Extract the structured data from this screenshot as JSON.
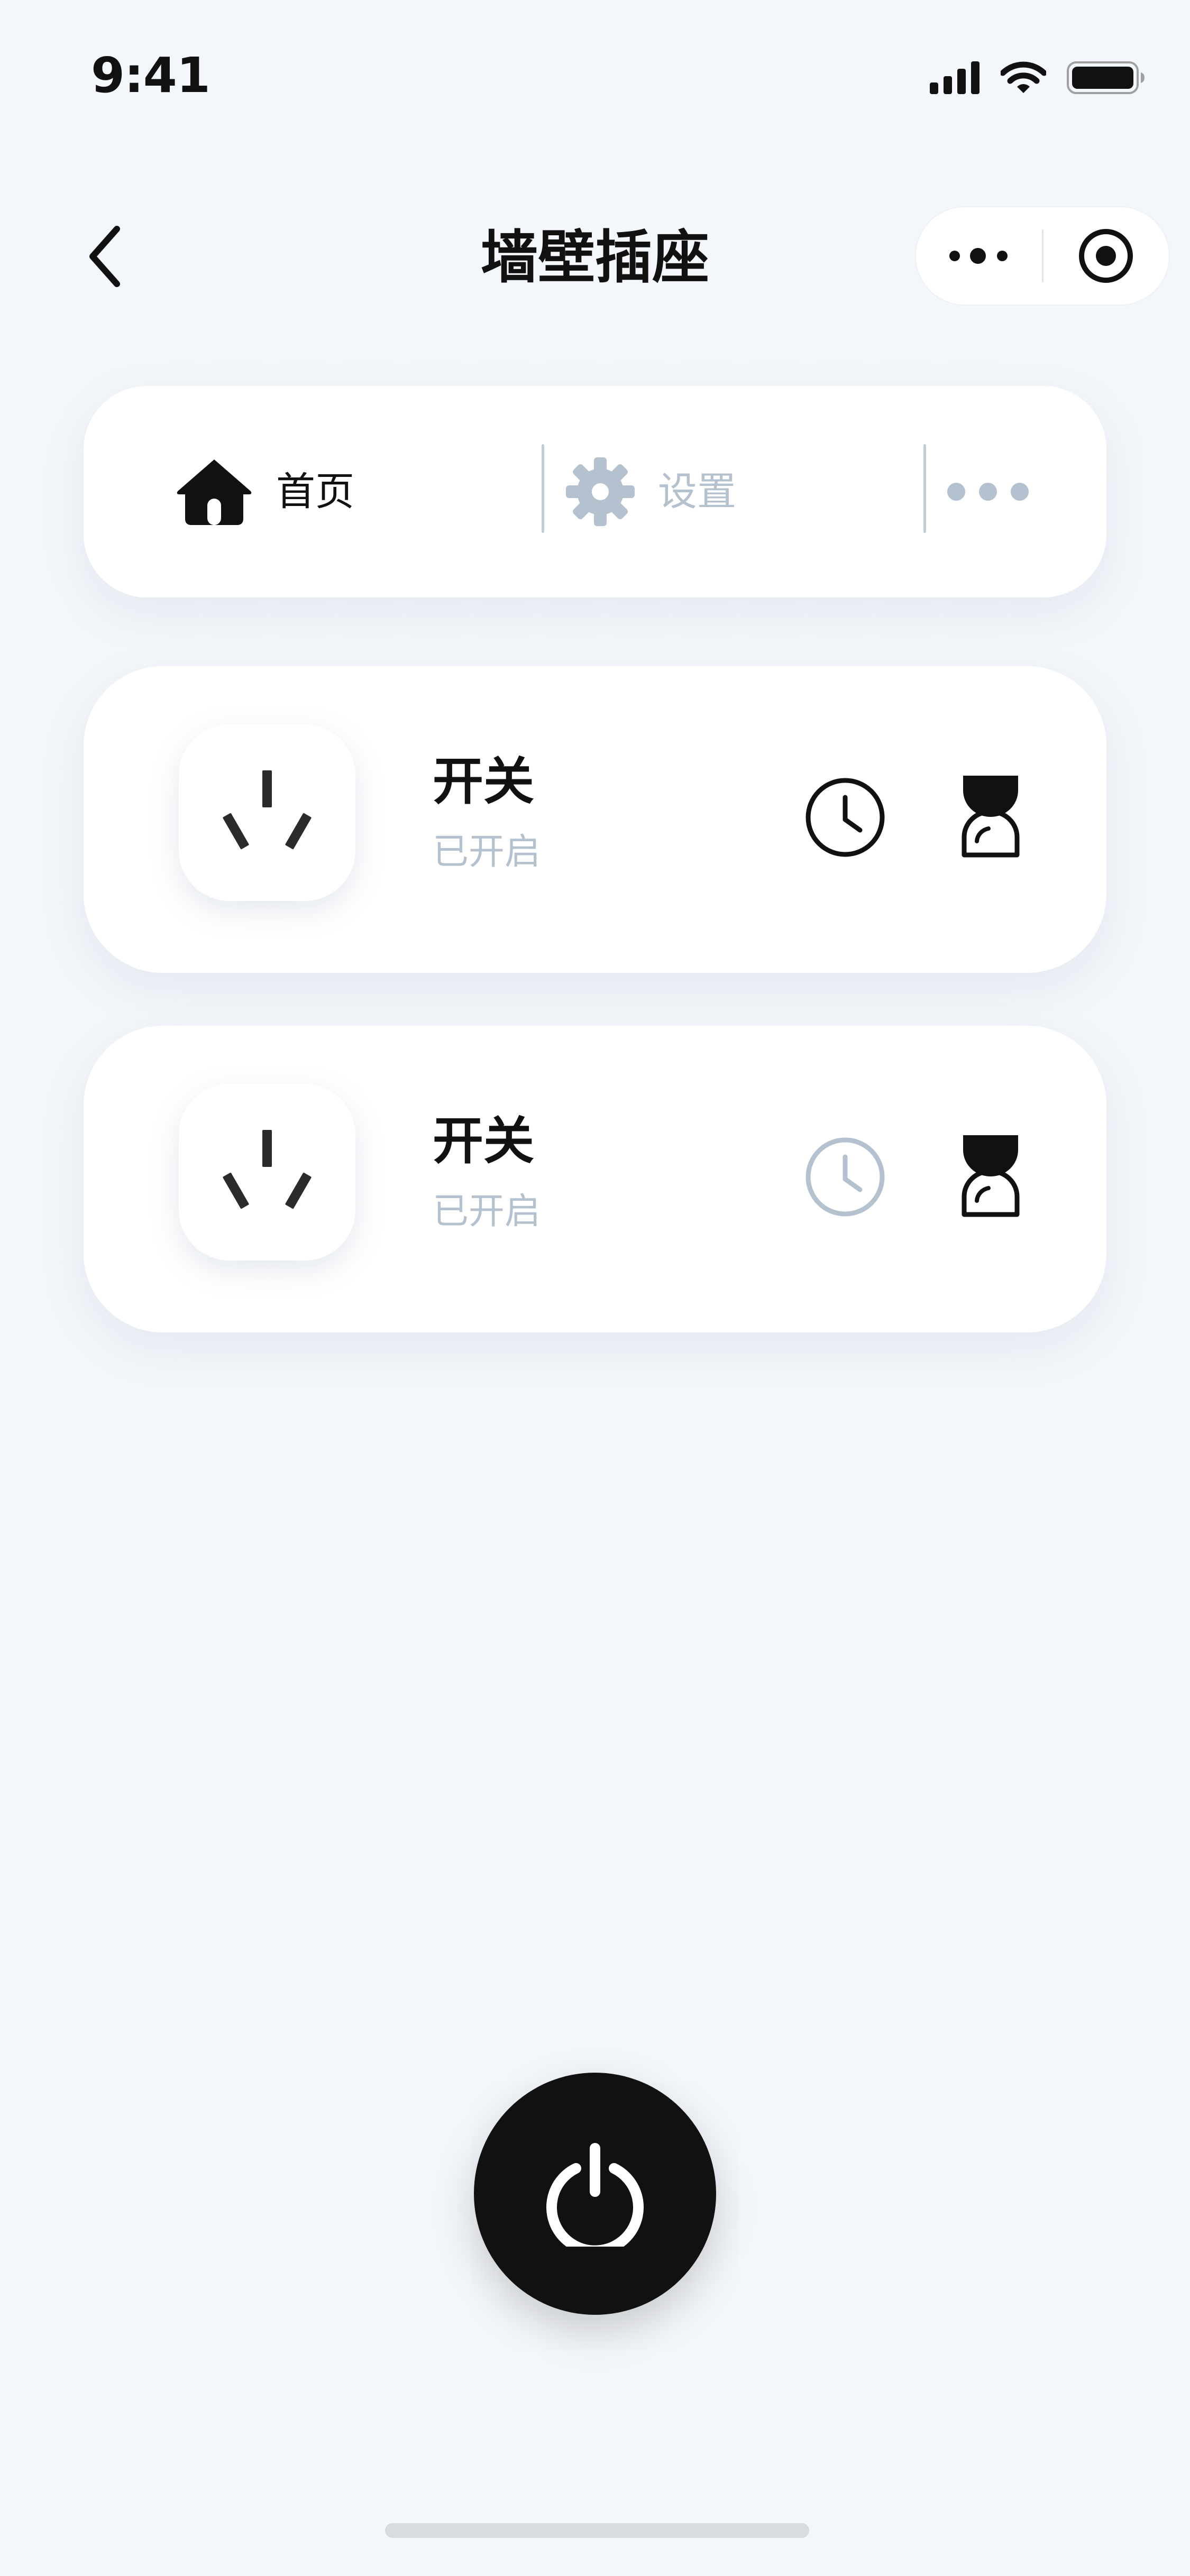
{
  "status_bar": {
    "time": "9:41",
    "icons": [
      "cellular-signal-icon",
      "wifi-icon",
      "battery-icon"
    ]
  },
  "nav": {
    "title": "墙壁插座",
    "back_icon": "chevron-left-icon",
    "capsule_icons": [
      "more-dots-icon",
      "target-close-icon"
    ]
  },
  "tabs": [
    {
      "label": "首页",
      "icon": "house-icon",
      "active": true
    },
    {
      "label": "设置",
      "icon": "gear-icon",
      "active": false
    },
    {
      "label": "",
      "icon": "more-dots-icon",
      "active": false
    }
  ],
  "sockets": [
    {
      "name": "开关",
      "status": "已开启",
      "icon": "socket-outlet-icon",
      "timer_icon": "clock-icon",
      "timer_active": true,
      "countdown_icon": "hourglass-icon"
    },
    {
      "name": "开关",
      "status": "已开启",
      "icon": "socket-outlet-icon",
      "timer_icon": "clock-icon",
      "timer_active": false,
      "countdown_icon": "hourglass-icon"
    }
  ],
  "power_button": {
    "icon": "power-icon"
  },
  "colors": {
    "background": "#f3f6fa",
    "card": "#ffffff",
    "primary": "#111111",
    "muted": "#b4c1cf",
    "divider": "#c2ccd7"
  }
}
